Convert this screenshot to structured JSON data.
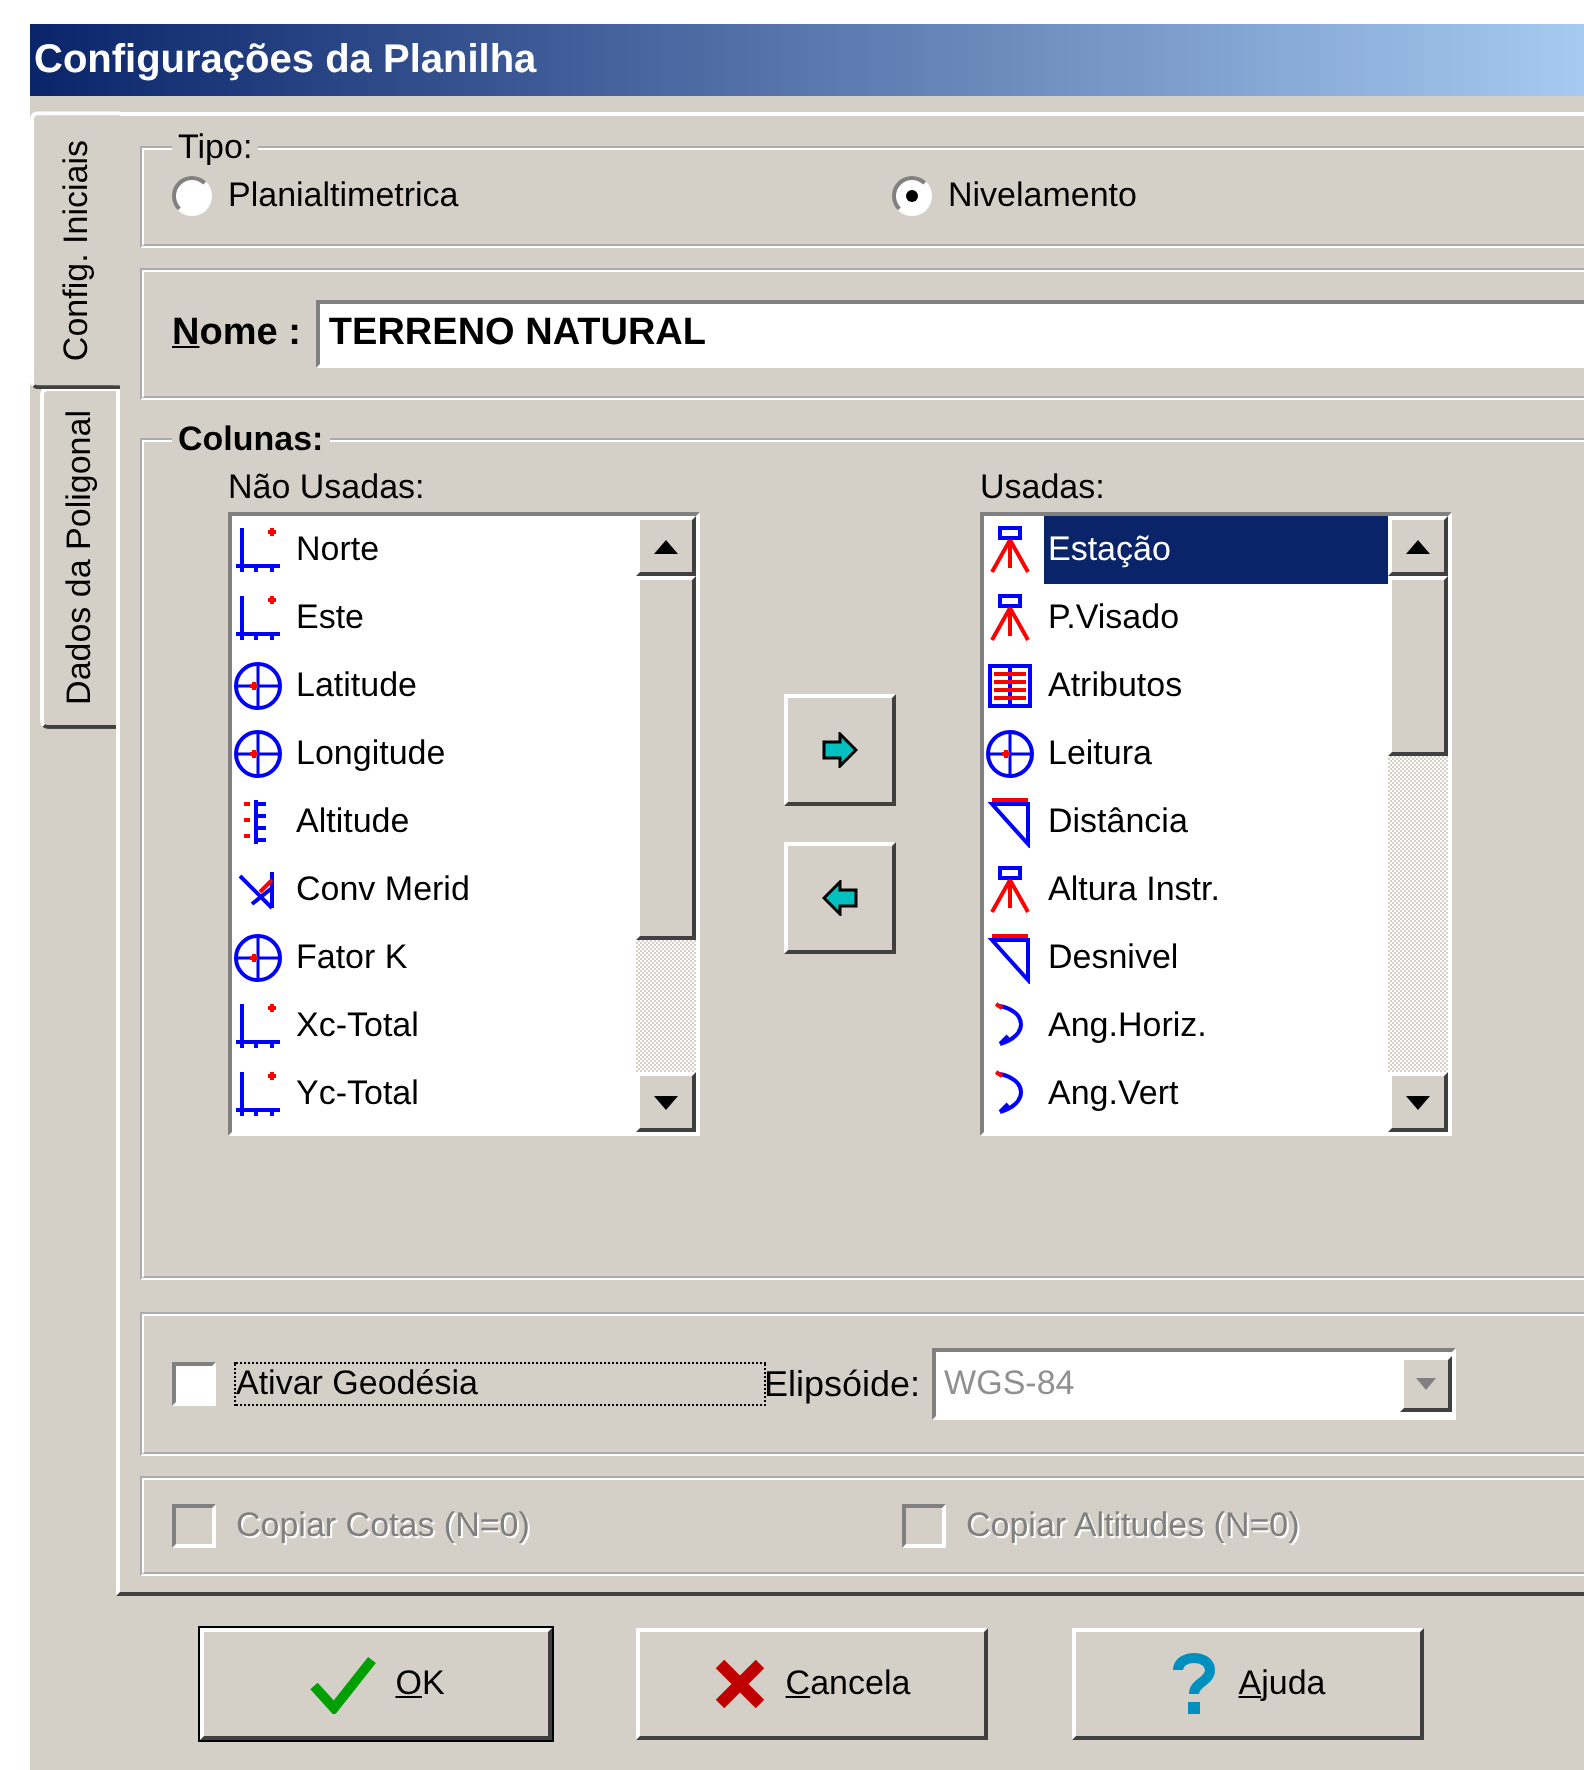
{
  "window": {
    "title": "Configurações da Planilha"
  },
  "side_tabs": [
    {
      "label": "Config. Iniciais",
      "selected": true
    },
    {
      "label": "Dados da Poligonal",
      "selected": false
    }
  ],
  "tipo": {
    "legend": "Tipo:",
    "options": [
      {
        "label": "Planialtimetrica",
        "selected": false
      },
      {
        "label": "Nivelamento",
        "selected": true
      }
    ]
  },
  "nome": {
    "label": "Nome :",
    "value": "TERRENO NATURAL"
  },
  "colunas": {
    "legend": "Colunas:",
    "nao_usadas": {
      "label": "Não Usadas:",
      "items": [
        {
          "label": "Norte",
          "selected": false
        },
        {
          "label": "Este",
          "selected": false
        },
        {
          "label": "Latitude",
          "selected": false
        },
        {
          "label": "Longitude",
          "selected": false
        },
        {
          "label": "Altitude",
          "selected": false
        },
        {
          "label": "Conv Merid",
          "selected": false
        },
        {
          "label": "Fator K",
          "selected": false
        },
        {
          "label": "Xc-Total",
          "selected": false
        },
        {
          "label": "Yc-Total",
          "selected": false
        }
      ]
    },
    "usadas": {
      "label": "Usadas:",
      "items": [
        {
          "label": "Estação",
          "selected": true
        },
        {
          "label": "P.Visado",
          "selected": false
        },
        {
          "label": "Atributos",
          "selected": false
        },
        {
          "label": "Leitura",
          "selected": false
        },
        {
          "label": "Distância",
          "selected": false
        },
        {
          "label": "Altura Instr.",
          "selected": false
        },
        {
          "label": "Desnivel",
          "selected": false
        },
        {
          "label": "Ang.Horiz.",
          "selected": false
        },
        {
          "label": "Ang.Vert",
          "selected": false
        }
      ]
    }
  },
  "geodesia": {
    "checkbox": {
      "label": "Ativar Geodésia",
      "checked": false
    },
    "elipsoide": {
      "label": "Elipsóide:",
      "value": "WGS-84",
      "disabled": true
    }
  },
  "copiar": [
    {
      "label": "Copiar Cotas (N=0)",
      "checked": false,
      "disabled": true
    },
    {
      "label": "Copiar Altitudes (N=0)",
      "checked": false,
      "disabled": true
    }
  ],
  "buttons": [
    {
      "label": "OK",
      "kind": "ok"
    },
    {
      "label": "Cancela",
      "kind": "cancel"
    },
    {
      "label": "Ajuda",
      "kind": "help"
    }
  ]
}
